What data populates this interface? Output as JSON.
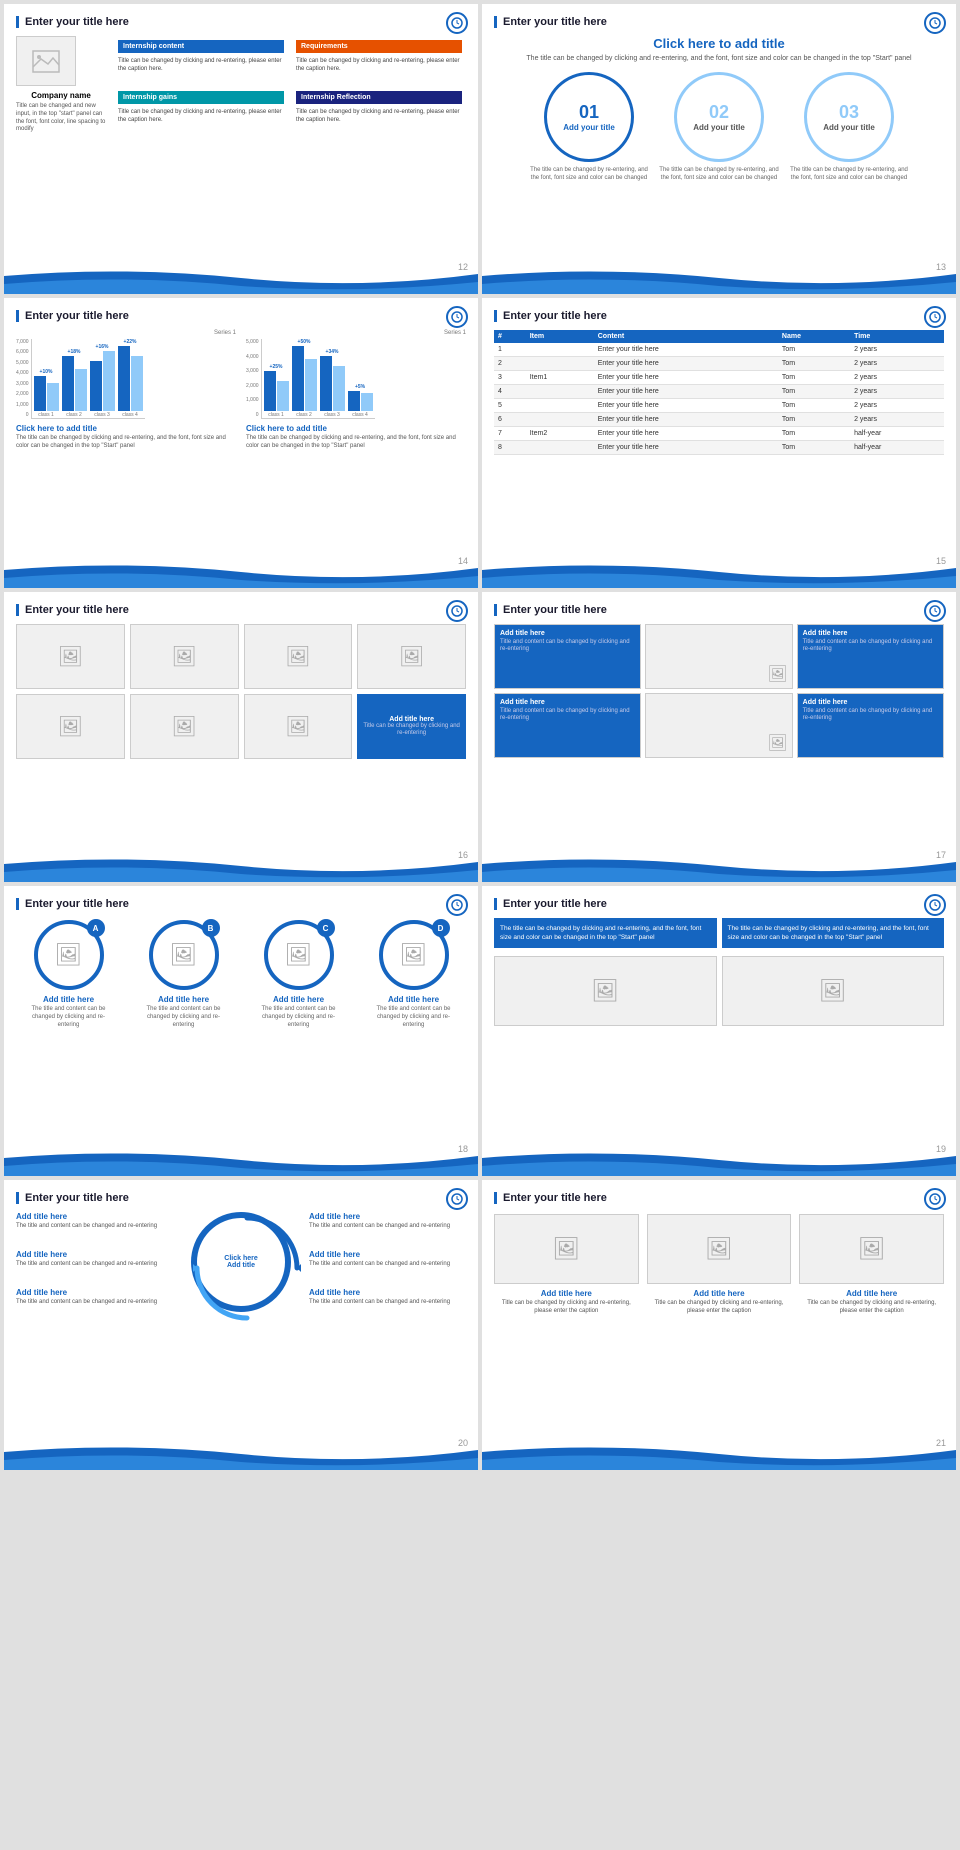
{
  "slides": [
    {
      "id": 12,
      "title": "Enter your title here",
      "num": "12",
      "company": "Company name",
      "company_desc": "Title can be changed and new input, in the top \"start\" panel can the font, font color, line spacing to modify",
      "boxes": [
        {
          "header": "Internship content",
          "color": "blue",
          "text": "Title can be changed by clicking and re-entering, please enter the caption here."
        },
        {
          "header": "Requirements",
          "color": "orange",
          "text": "Title can be changed by clicking and re-entering, please enter the caption here."
        },
        {
          "header": "Internship gains",
          "color": "cyan",
          "text": "Title can be changed by clicking and re-entering, please enter the caption here."
        },
        {
          "header": "Internship Reflection",
          "color": "dark-blue",
          "text": "Title can be changed by clicking and re-entering, please enter the caption here."
        }
      ]
    },
    {
      "id": 13,
      "title": "Enter your title here",
      "num": "13",
      "main_title": "Click here to add title",
      "sub_text": "The title can be changed by clicking and re-entering, and the font, font size and color can be changed in the top \"Start\" panel",
      "circles": [
        {
          "num": "01",
          "title": "Add your title",
          "desc": "The title can be changed by re-entering, and the font, font size and color can be changed",
          "style": "filled"
        },
        {
          "num": "02",
          "title": "Add your title",
          "desc": "The tittle can be changed by re-entering, and the font, font size and color can be changed",
          "style": "light"
        },
        {
          "num": "03",
          "title": "Add your title",
          "desc": "The title can be changed by re-entering, and the font, font size and color can be changed",
          "style": "light"
        }
      ]
    },
    {
      "id": 14,
      "title": "Enter your title here",
      "num": "14",
      "chart1": {
        "legend": "Series 1",
        "title": "Click here to add title",
        "desc": "The title can be changed by clicking and re-entering, and the font, font size and color can be changed in the top \"Start\" panel",
        "bars": [
          {
            "label": "class 1",
            "pct": "+10%",
            "h1": 35,
            "h2": 28
          },
          {
            "label": "class 2",
            "pct": "+18%",
            "h1": 55,
            "h2": 42
          },
          {
            "label": "class 3",
            "pct": "+16%",
            "h1": 50,
            "h2": 60
          },
          {
            "label": "class 4",
            "pct": "+22%",
            "h1": 65,
            "h2": 55
          }
        ],
        "yLabels": [
          "7,000",
          "6,000",
          "5,000",
          "4,000",
          "3,000",
          "2,000",
          "1,000",
          "0"
        ]
      },
      "chart2": {
        "legend": "Series 1",
        "title": "Click here to add title",
        "desc": "The title can be changed by clicking and re-entering, and the font, font size and color can be changed in the top \"Start\" panel",
        "bars": [
          {
            "label": "class 1",
            "pct": "+25%",
            "h1": 40,
            "h2": 30
          },
          {
            "label": "class 2",
            "pct": "+50%",
            "h1": 65,
            "h2": 52
          },
          {
            "label": "class 3",
            "pct": "+34%",
            "h1": 55,
            "h2": 45
          },
          {
            "label": "class 4",
            "pct": "+5%",
            "h1": 20,
            "h2": 18
          }
        ],
        "yLabels": [
          "5,000",
          "4,000",
          "3,000",
          "2,000",
          "1,000",
          "0"
        ]
      }
    },
    {
      "id": 15,
      "title": "Enter your title here",
      "num": "15",
      "table": {
        "headers": [
          "#",
          "Item",
          "Content",
          "Name",
          "Time"
        ],
        "rows": [
          [
            "1",
            "",
            "Enter your title here",
            "Tom",
            "2 years"
          ],
          [
            "2",
            "",
            "Enter your title here",
            "Tom",
            "2 years"
          ],
          [
            "3",
            "Item1",
            "Enter your title here",
            "Tom",
            "2 years"
          ],
          [
            "4",
            "",
            "Enter your title here",
            "Tom",
            "2 years"
          ],
          [
            "5",
            "",
            "Enter your title here",
            "Tom",
            "2 years"
          ],
          [
            "6",
            "",
            "Enter your title here",
            "Tom",
            "2 years"
          ],
          [
            "7",
            "Item2",
            "Enter your title here",
            "Tom",
            "half-year"
          ],
          [
            "8",
            "",
            "Enter your title here",
            "Tom",
            "half-year"
          ]
        ]
      }
    },
    {
      "id": 16,
      "title": "Enter your title here",
      "num": "16",
      "highlighted_title": "Add title here",
      "highlighted_text": "Title can be changed by clicking and re-entering"
    },
    {
      "id": 17,
      "title": "Enter your title here",
      "num": "17",
      "cells": [
        {
          "title": "Add title here",
          "text": "Title and content can be changed by clicking and re-entering",
          "blue": true,
          "top": true
        },
        {
          "title": "",
          "text": "",
          "blue": false,
          "top": true
        },
        {
          "title": "Add title here",
          "text": "Title and content can be changed by clicking and re-entering",
          "blue": true,
          "top": true
        },
        {
          "title": "Add title here",
          "text": "Title and content can be changed by clicking and re-entering",
          "blue": true,
          "top": false
        },
        {
          "title": "",
          "text": "",
          "blue": false,
          "top": false
        },
        {
          "title": "Add title here",
          "text": "Title and content can be changed by clicking and re-entering",
          "blue": true,
          "top": false
        },
        {
          "title": "Add title here",
          "text": "Title and content can be changed by clicking and re-entering",
          "blue": true,
          "top": false
        }
      ]
    },
    {
      "id": 18,
      "title": "Enter your title here",
      "num": "18",
      "items": [
        {
          "letter": "A",
          "title": "Add title here",
          "text": "The title and content can be changed by clicking and re-entering"
        },
        {
          "letter": "B",
          "title": "Add title here",
          "text": "The title and content can be changed by clicking and re-entering"
        },
        {
          "letter": "C",
          "title": "Add title here",
          "text": "The title and content can be changed by clicking and re-entering"
        },
        {
          "letter": "D",
          "title": "Add title here",
          "text": "The title and content can be changed by clicking and re-entering"
        }
      ]
    },
    {
      "id": 19,
      "title": "Enter your title here",
      "num": "19",
      "text1": "The title can be changed by clicking and re-entering, and the font, font size and color can be changed in the top \"Start\" panel",
      "text2": "The title can be changed by clicking and re-entering, and the font, font size and color can be changed in the top \"Start\" panel"
    },
    {
      "id": 20,
      "title": "Enter your title here",
      "num": "20",
      "cycle_text1": "Click here",
      "cycle_text2": "Add title",
      "left_items": [
        {
          "title": "Add title here",
          "text": "The title and content can be changed and re-entering"
        },
        {
          "title": "Add title here",
          "text": "The title and content can be changed and re-entering"
        },
        {
          "title": "Add title here",
          "text": "The title and content can be changed and re-entering"
        }
      ],
      "right_items": [
        {
          "title": "Add title here",
          "text": "The title and content can be changed and re-entering"
        },
        {
          "title": "Add title here",
          "text": "The title and content can be changed and re-entering"
        },
        {
          "title": "Add title here",
          "text": "The title and content can be changed and re-entering"
        }
      ]
    },
    {
      "id": 21,
      "title": "Enter your title here",
      "num": "21",
      "cards": [
        {
          "title": "Add title here",
          "text": "Title can be changed by clicking and re-entering, please enter the caption"
        },
        {
          "title": "Add title here",
          "text": "Title can be changed by clicking and re-entering, please enter the caption"
        },
        {
          "title": "Add title here",
          "text": "Title can be changed by clicking and re-entering, please enter the caption"
        }
      ]
    }
  ]
}
